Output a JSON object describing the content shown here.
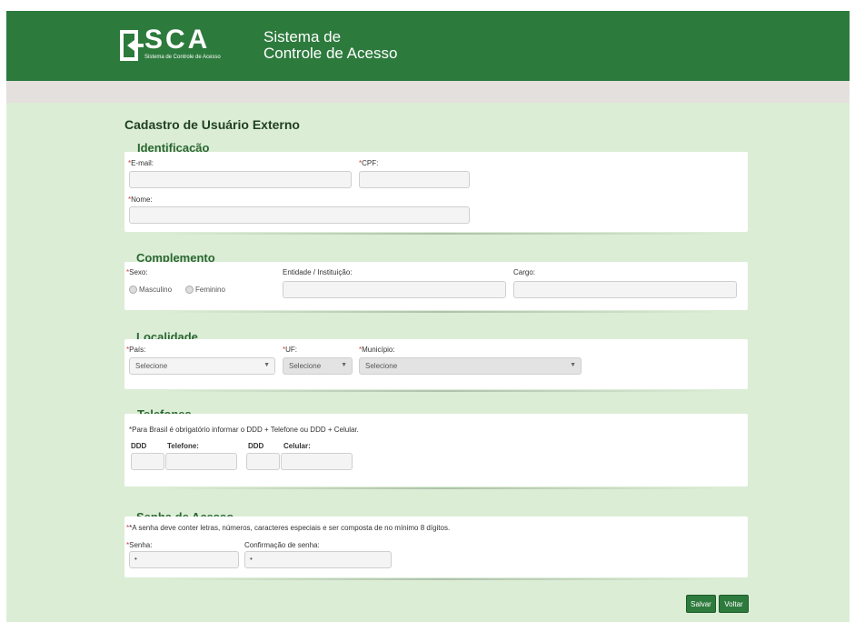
{
  "header": {
    "logo": "SCA",
    "logo_subtitle": "Sistema de Controle de Acesso",
    "system_title_line1": "Sistema de",
    "system_title_line2": "Controle de Acesso"
  },
  "page_title": "Cadastro de Usuário Externo",
  "identificacao": {
    "legend": "Identificação",
    "email_label": "E-mail:",
    "cpf_label": "CPF:",
    "nome_label": "Nome:"
  },
  "complemento": {
    "legend": "Complemento",
    "sexo_label": "Sexo:",
    "masculino": "Masculino",
    "feminino": "Feminino",
    "entidade_label": "Entidade / Instituição:",
    "cargo_label": "Cargo:"
  },
  "localidade": {
    "legend": "Localidade",
    "pais_label": "País:",
    "pais_value": "Selecione",
    "uf_label": "UF:",
    "uf_value": "Selecione",
    "municipio_label": "Município:",
    "municipio_value": "Selecione"
  },
  "telefones": {
    "legend": "Telefones",
    "note": "*Para Brasil é obrigatório informar o DDD + Telefone ou DDD + Celular.",
    "ddd1_label": "DDD",
    "telefone_label": "Telefone:",
    "ddd2_label": "DDD",
    "celular_label": "Celular:"
  },
  "senha": {
    "legend": "Senha de Acesso",
    "note": "*A senha deve conter letras, números, caracteres especiais e ser composta de no mínimo 8 dígitos.",
    "senha_label": "Senha:",
    "senha_value": "•",
    "confirmacao_label": "Confirmação de senha:",
    "confirmacao_value": "•"
  },
  "actions": {
    "salvar": "Salvar",
    "voltar": "Voltar"
  },
  "required_mark": "*",
  "colors": {
    "header_green": "#2d7a3d",
    "page_background": "#dcedd6",
    "required_red": "#d24040"
  }
}
